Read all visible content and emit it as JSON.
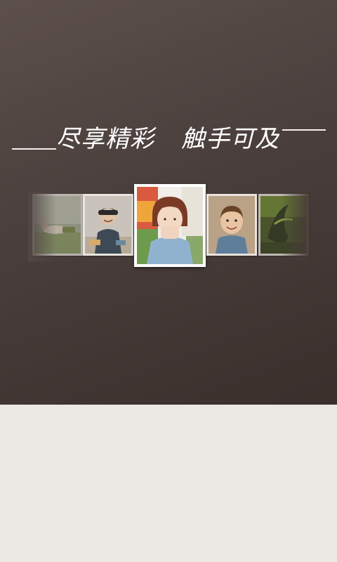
{
  "slogan": {
    "left_text": "尽享精彩",
    "right_text": "触手可及"
  },
  "colors": {
    "hero_background": "#4a3f3c",
    "footer_background": "#efebe6",
    "slogan_text": "#ffffff",
    "photo_border": "#ffffff"
  },
  "gallery": {
    "photos": [
      {
        "name": "photo-reclining-person"
      },
      {
        "name": "photo-smiling-woman-cap"
      },
      {
        "name": "photo-short-hair-girl"
      },
      {
        "name": "photo-smiling-boy"
      },
      {
        "name": "photo-green-plant"
      }
    ]
  }
}
